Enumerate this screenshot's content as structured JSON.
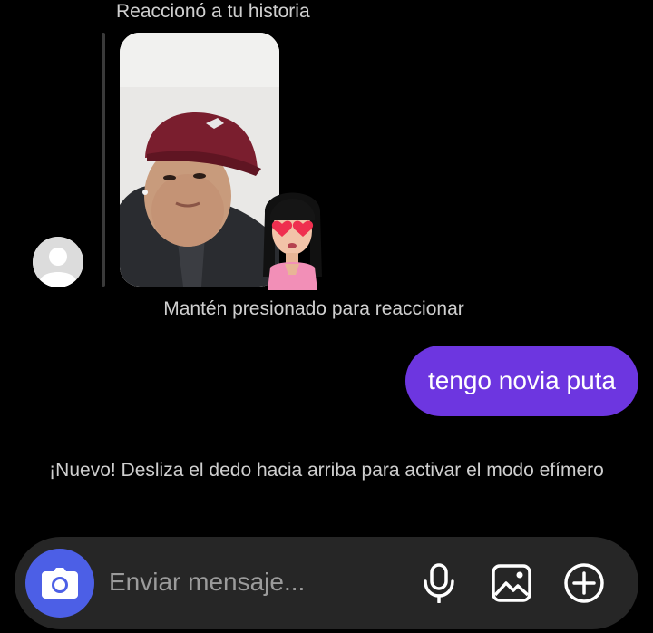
{
  "story": {
    "caption": "Reaccionó a tu historia",
    "reaction_hint": "Mantén presionado para reaccionar"
  },
  "messages": [
    {
      "text": "tengo novia puta",
      "sender": "me"
    }
  ],
  "notice": "¡Nuevo! Desliza el dedo hacia arriba para activar el modo efímero",
  "composer": {
    "placeholder": "Enviar mensaje...",
    "icons": [
      "camera-icon",
      "microphone-icon",
      "image-icon",
      "plus-circle-icon"
    ]
  },
  "colors": {
    "background": "#000000",
    "bubble": "#6d36e0",
    "camera": "#4c5fe6",
    "composer": "#262626"
  }
}
